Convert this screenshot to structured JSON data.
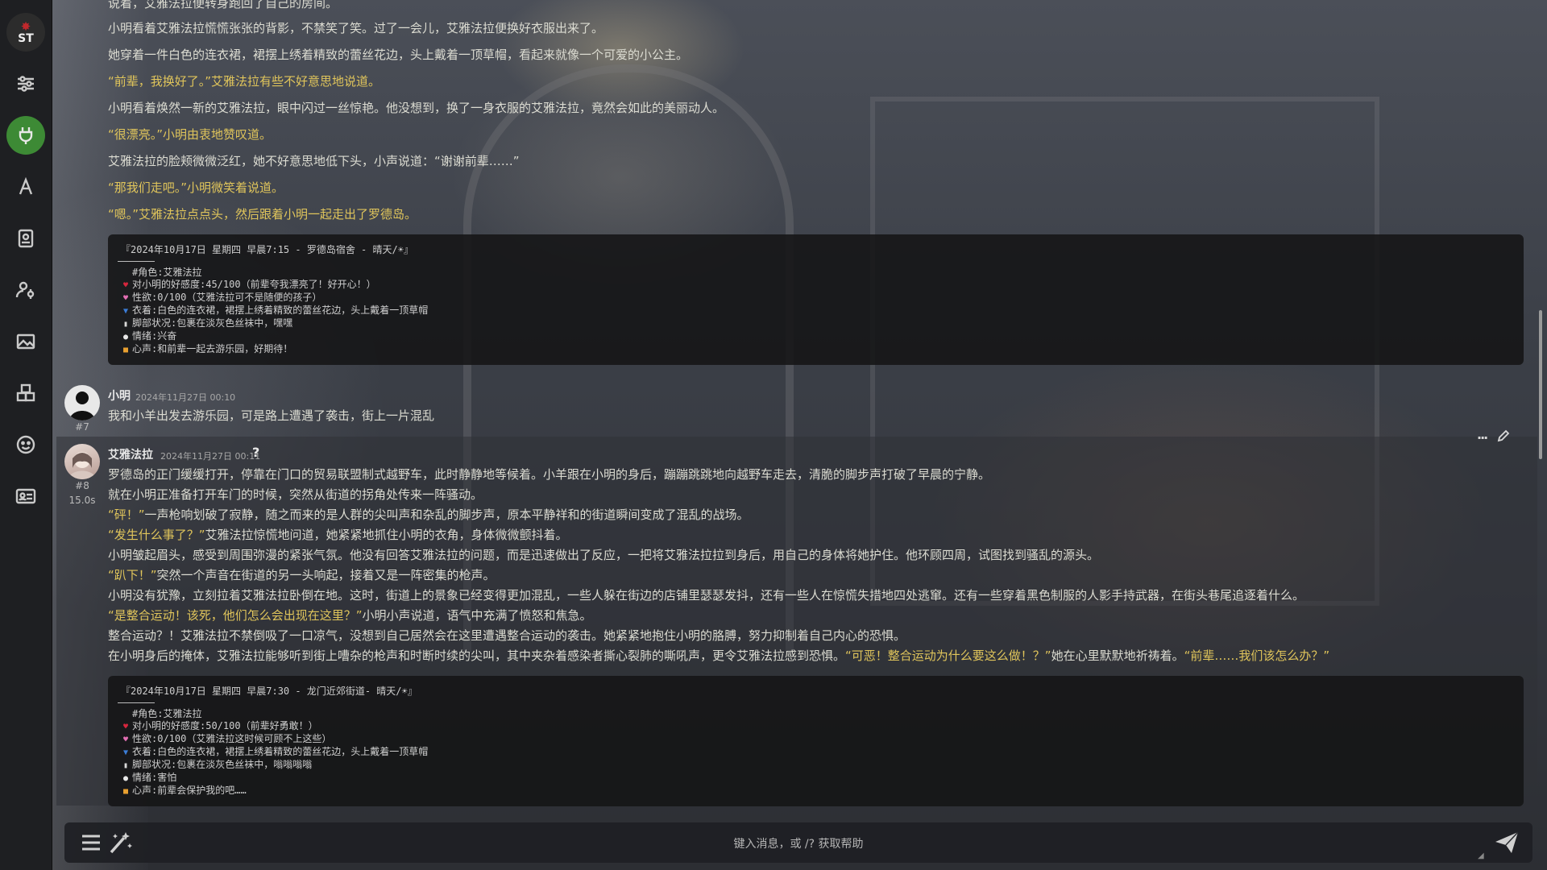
{
  "app": {
    "logo_text": "ST"
  },
  "sidebar": {
    "items": [
      {
        "icon": "sliders-icon"
      },
      {
        "icon": "plug-icon",
        "active": true
      },
      {
        "icon": "text-a-icon"
      },
      {
        "icon": "book-icon"
      },
      {
        "icon": "user-gear-icon"
      },
      {
        "icon": "image-icon"
      },
      {
        "icon": "cubes-icon"
      },
      {
        "icon": "smile-icon"
      },
      {
        "icon": "id-card-icon"
      }
    ]
  },
  "prev_message": {
    "lines": [
      "说着，艾雅法拉便转身跑回了自己的房间。",
      "小明看着艾雅法拉慌慌张张的背影，不禁笑了笑。过了一会儿，艾雅法拉便换好衣服出来了。",
      "她穿着一件白色的连衣裙，裙摆上绣着精致的蕾丝花边，头上戴着一顶草帽，看起来就像一个可爱的小公主。",
      "“前辈，我换好了。”艾雅法拉有些不好意思地说道。",
      "小明看着焕然一新的艾雅法拉，眼中闪过一丝惊艳。他没想到，换了一身衣服的艾雅法拉，竟然会如此的美丽动人。",
      "“很漂亮。”小明由衷地赞叹道。",
      "艾雅法拉的脸颊微微泛红，她不好意思地低下头，小声说道：“谢谢前辈……”",
      "“那我们走吧。”小明微笑着说道。",
      "“嗯。”艾雅法拉点点头，然后跟着小明一起走出了罗德岛。"
    ],
    "status": {
      "header": "『2024年10月17日 星期四 早晨7:15 - 罗德岛宿舍 - 晴天/☀』",
      "lines": [
        {
          "icon": "",
          "text": "#角色:艾雅法拉"
        },
        {
          "icon": "heart-icon",
          "text": "对小明的好感度:45/100（前辈夸我漂亮了！好开心！）"
        },
        {
          "icon": "pink-heart-icon",
          "text": "性欲:0/100（艾雅法拉可不是随便的孩子）"
        },
        {
          "icon": "shirt-icon",
          "text": "衣着:白色的连衣裙，裙摆上绣着精致的蕾丝花边，头上戴着一顶草帽"
        },
        {
          "icon": "sock-icon",
          "text": "脚部状况:包裹在淡灰色丝袜中，嘿嘿"
        },
        {
          "icon": "speech-icon",
          "text": "情绪:兴奋"
        },
        {
          "icon": "heart-box-icon",
          "text": "心声:和前辈一起去游乐园，好期待！"
        }
      ]
    }
  },
  "message7": {
    "name": "小明",
    "timestamp": "2024年11月27日 00:10",
    "id": "#7",
    "text": "我和小羊出发去游乐园，可是路上遭遇了袭击，街上一片混乱"
  },
  "message8": {
    "name": "艾雅法拉",
    "timestamp": "2024年11月27日 00:11",
    "id": "#8",
    "gen_time": "15.0s",
    "help": "?",
    "menu": "···",
    "lines": [
      "罗德岛的正门缓缓打开，停靠在门口的贸易联盟制式越野车，此时静静地等候着。小羊跟在小明的身后，蹦蹦跳跳地向越野车走去，清脆的脚步声打破了早晨的宁静。",
      "就在小明正准备打开车门的时候，突然从街道的拐角处传来一阵骚动。",
      "“砰！”一声枪响划破了寂静，随之而来的是人群的尖叫声和杂乱的脚步声，原本平静祥和的街道瞬间变成了混乱的战场。",
      "“发生什么事了？”艾雅法拉惊慌地问道，她紧紧地抓住小明的衣角，身体微微颤抖着。",
      "小明皱起眉头，感受到周围弥漫的紧张气氛。他没有回答艾雅法拉的问题，而是迅速做出了反应，一把将艾雅法拉拉到身后，用自己的身体将她护住。他环顾四周，试图找到骚乱的源头。",
      "“趴下！”突然一个声音在街道的另一头响起，接着又是一阵密集的枪声。",
      "小明没有犹豫，立刻拉着艾雅法拉卧倒在地。这时，街道上的景象已经变得更加混乱，一些人躲在街边的店铺里瑟瑟发抖，还有一些人在惊慌失措地四处逃窜。还有一些穿着黑色制服的人影手持武器，在街头巷尾追逐着什么。",
      "“是整合运动！该死，他们怎么会出现在这里？”小明小声说道，语气中充满了愤怒和焦急。",
      "整合运动？！艾雅法拉不禁倒吸了一口凉气，没想到自己居然会在这里遭遇整合运动的袭击。她紧紧地抱住小明的胳膊，努力抑制着自己内心的恐惧。",
      "在小明身后的掩体，艾雅法拉能够听到街上嘈杂的枪声和时断时续的尖叫，其中夹杂着感染者撕心裂肺的嘶吼声，更令艾雅法拉感到恐惧。“可恶！整合运动为什么要这么做！？”她在心里默默地祈祷着。“前辈……我们该怎么办？”"
    ],
    "status": {
      "header": "『2024年10月17日 星期四 早晨7:30 - 龙门近郊街道- 晴天/☀』",
      "lines": [
        {
          "icon": "",
          "text": "#角色:艾雅法拉"
        },
        {
          "icon": "heart-icon",
          "text": "对小明的好感度:50/100（前辈好勇敢！）"
        },
        {
          "icon": "pink-heart-icon",
          "text": "性欲:0/100（艾雅法拉这时候可顾不上这些）"
        },
        {
          "icon": "shirt-icon",
          "text": "衣着:白色的连衣裙，裙摆上绣着精致的蕾丝花边，头上戴着一顶草帽"
        },
        {
          "icon": "sock-icon",
          "text": "脚部状况:包裹在淡灰色丝袜中，嗡嗡嗡嗡"
        },
        {
          "icon": "speech-icon",
          "text": "情绪:害怕"
        },
        {
          "icon": "heart-box-icon",
          "text": "心声:前辈会保护我的吧……"
        }
      ]
    }
  },
  "input": {
    "placeholder": "键入消息，或 /? 获取帮助"
  }
}
